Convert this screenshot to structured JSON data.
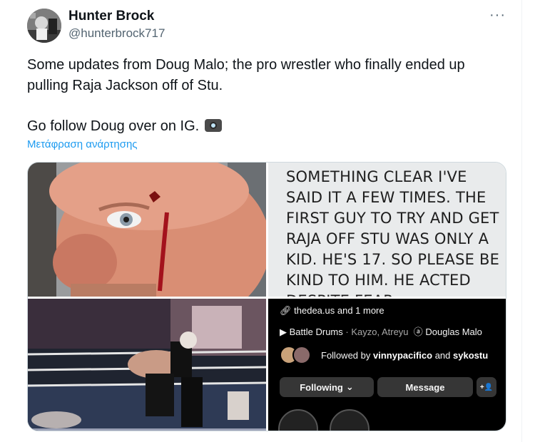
{
  "author": {
    "name": "Hunter Brock",
    "handle": "@hunterbrock717"
  },
  "more_glyph": "···",
  "tweet": {
    "text_line1": "Some updates from Doug Malo; the pro wrestler who finally ended up pulling Raja Jackson off of Stu.",
    "text_line2": "Go follow Doug over on IG.",
    "emoji_icon": "camera-with-flash-icon",
    "translate_label": "Μετάφραση ανάρτησης"
  },
  "media": {
    "note_text": "Something clear I've said it a few times. The first guy to try and get Raja off Stu was only a kid. He's 17. So please be kind to him. He acted despite fear",
    "instagram": {
      "link": "thedea.us and 1 more",
      "music_title": "Battle Drums",
      "music_artists": "· Kayzo, Atreyu",
      "threads_name": "Douglas Malo",
      "followed_prefix": "Followed by",
      "followed_user1": "vinnypacifico",
      "followed_and": "and",
      "followed_user2": "sykostu",
      "following_button": "Following",
      "message_button": "Message",
      "add_person_glyph": "+👤"
    }
  },
  "colors": {
    "link_blue": "#1d9bf0",
    "secondary_text": "#536471",
    "instagram_bg": "#000000",
    "instagram_button": "#363636"
  }
}
